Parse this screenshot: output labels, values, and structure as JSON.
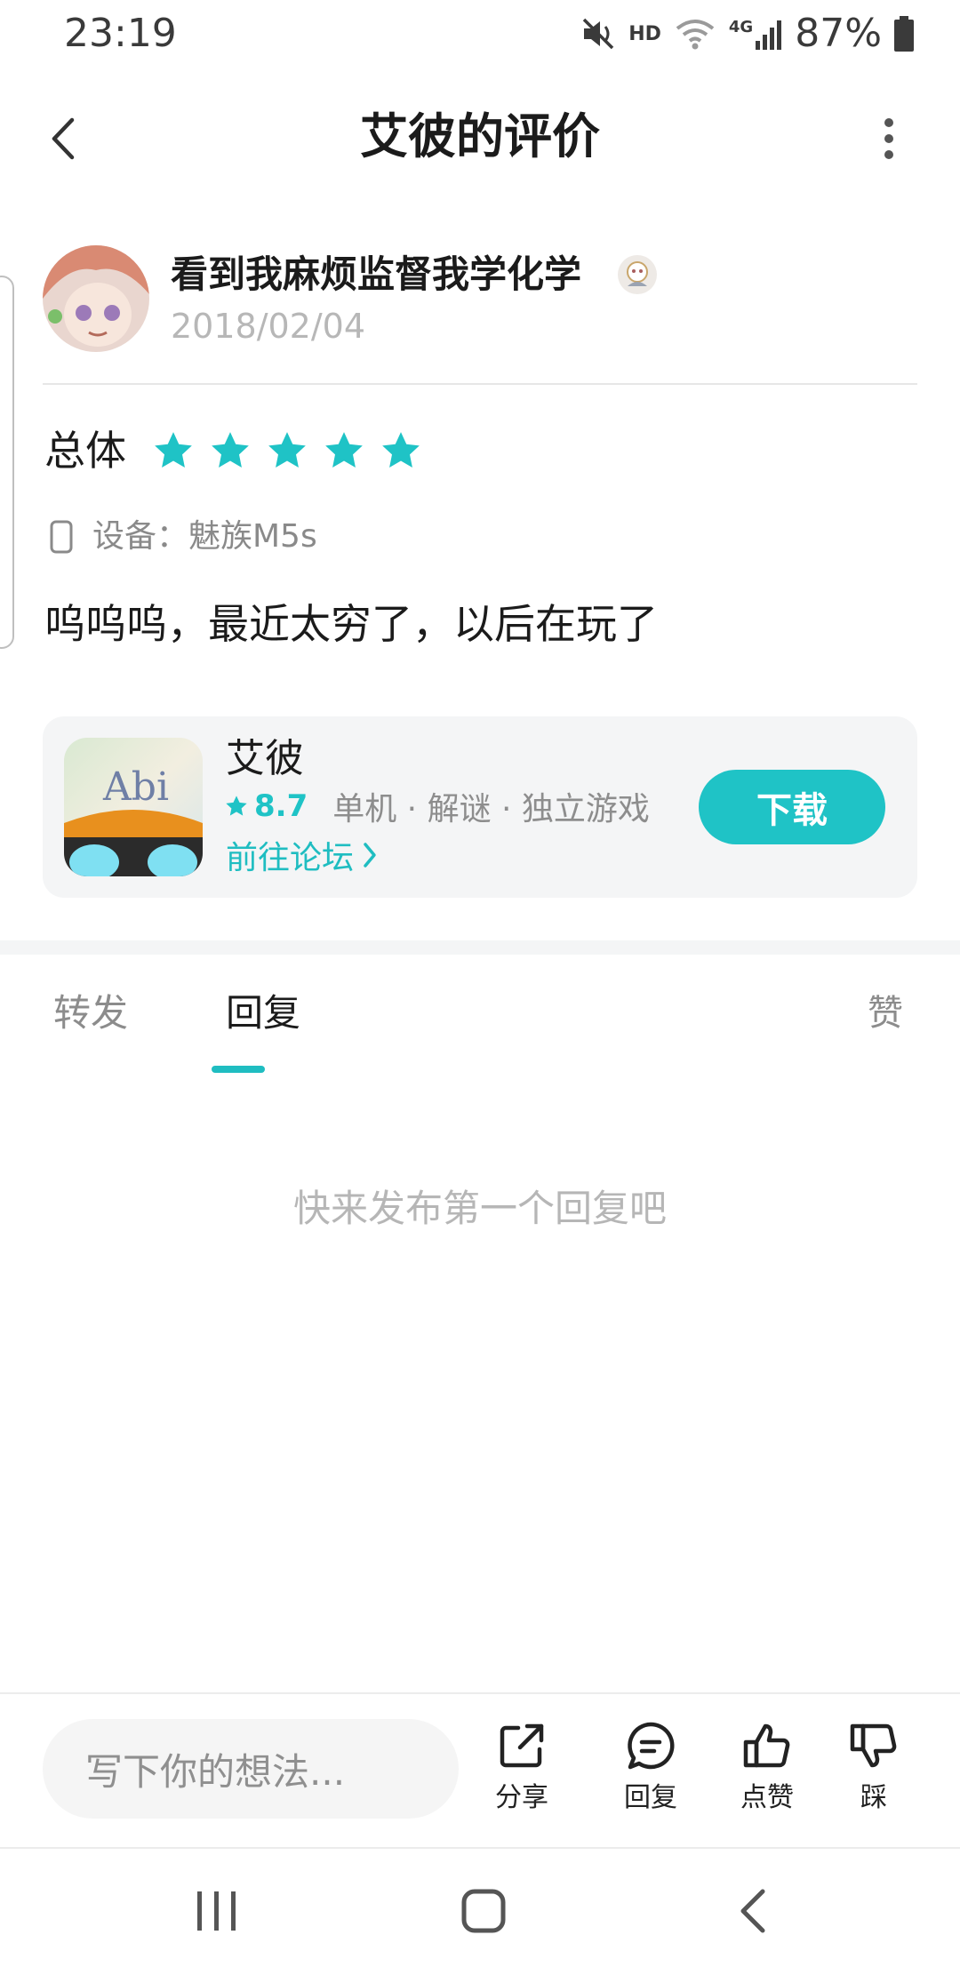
{
  "status_bar": {
    "time": "23:19",
    "battery": "87%",
    "icons": [
      "mute-icon",
      "hd-icon",
      "wifi-icon",
      "4g-signal-icon",
      "battery-icon"
    ],
    "hd_label": "HD",
    "network_label": "4G"
  },
  "header": {
    "title": "艾彼的评价",
    "back_icon": "chevron-left-icon",
    "more_icon": "more-vertical-icon"
  },
  "review": {
    "reviewer_name": "看到我麻烦监督我学化学",
    "date": "2018/02/04",
    "rating_label": "总体",
    "rating_stars": 5,
    "rating_max": 5,
    "device_label": "设备：魅族M5s",
    "text": "呜呜呜，最近太穷了，以后在玩了"
  },
  "app_card": {
    "icon_text": "Abi",
    "name": "艾彼",
    "score": "8.7",
    "tags": "单机 · 解谜 · 独立游戏",
    "forum_link": "前往论坛",
    "download_label": "下载"
  },
  "tabs": [
    {
      "label": "转发",
      "active": false
    },
    {
      "label": "回复",
      "active": true
    }
  ],
  "like_tab": "赞",
  "empty_state": "快来发布第一个回复吧",
  "bottom_bar": {
    "input_placeholder": "写下你的想法...",
    "actions": [
      {
        "label": "分享",
        "icon": "share-icon"
      },
      {
        "label": "回复",
        "icon": "comment-icon"
      },
      {
        "label": "点赞",
        "icon": "thumbs-up-icon"
      },
      {
        "label": "踩",
        "icon": "thumbs-down-icon"
      }
    ]
  },
  "colors": {
    "accent": "#1fc3c6",
    "text": "#1b1b1b",
    "muted": "#b7b7b7",
    "card_bg": "#f4f5f6"
  }
}
